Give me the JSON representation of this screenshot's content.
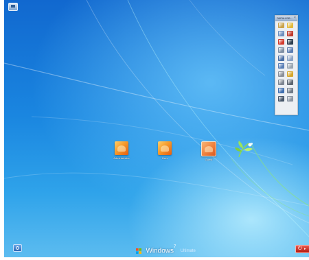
{
  "desktop": {
    "icons": [
      {
        "label": "Administrator"
      },
      {
        "label": "User"
      },
      {
        "label": "Guest"
      }
    ]
  },
  "tool_panel": {
    "title": "ЭКРАН ВВ...",
    "close_glyph": "×",
    "tools": [
      {
        "icon": "palette-icon",
        "color": "#c9a24a"
      },
      {
        "icon": "folder-icon",
        "color": "#e2b93b"
      },
      {
        "icon": "connect-icon",
        "color": "#6c8fbf"
      },
      {
        "icon": "pencil-icon",
        "color": "#c0392b"
      },
      {
        "icon": "delete-icon",
        "color": "#d33a2c"
      },
      {
        "icon": "monitor-icon",
        "color": "#2c3e50"
      },
      {
        "icon": "grid-icon",
        "color": "#7f8fa4"
      },
      {
        "icon": "window-icon",
        "color": "#5b7db1"
      },
      {
        "icon": "document-edit-icon",
        "color": "#4a6fa5"
      },
      {
        "icon": "document-icon",
        "color": "#8aa2c4"
      },
      {
        "icon": "document-list-icon",
        "color": "#5a7fb6"
      },
      {
        "icon": "copy-icon",
        "color": "#9aa6b2"
      },
      {
        "icon": "gear-icon",
        "color": "#8a8f99"
      },
      {
        "icon": "lock-icon",
        "color": "#d6a62b"
      },
      {
        "icon": "wrench-icon",
        "color": "#7d8591"
      },
      {
        "icon": "user-tool-icon",
        "color": "#5b6470"
      },
      {
        "icon": "save-icon",
        "color": "#3f6fb0"
      },
      {
        "icon": "pointer-icon",
        "color": "#6f7a88"
      },
      {
        "icon": "screen-icon",
        "color": "#465569"
      },
      {
        "icon": "settings-icon",
        "color": "#8b95a3"
      }
    ]
  },
  "branding": {
    "product": "Windows",
    "version": "7",
    "edition": "Ultimate"
  },
  "colors": {
    "power_button": "#c8281c",
    "desktop_blue": "#1a86e0"
  }
}
